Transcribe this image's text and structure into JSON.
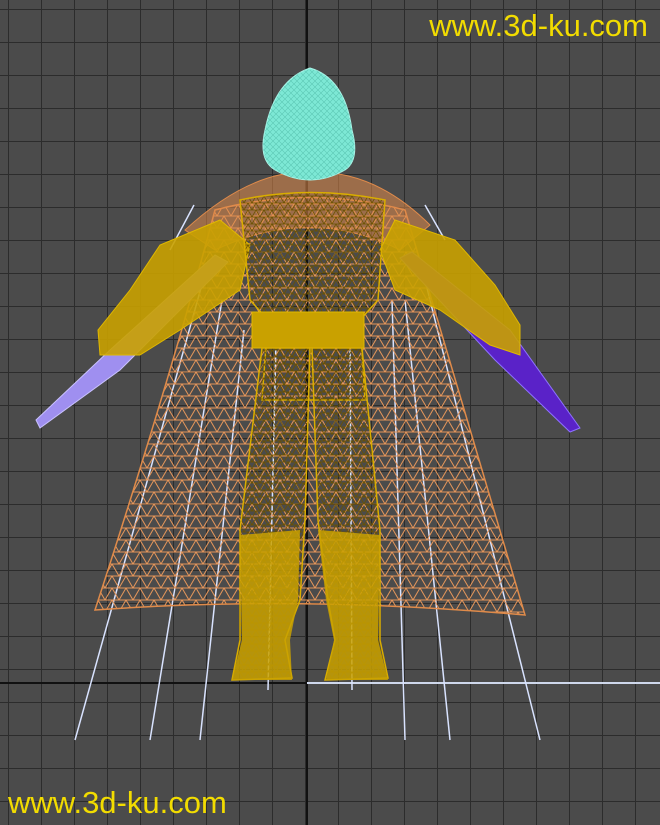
{
  "viewport": {
    "background_color": "#4b4b4b",
    "grid_color": "#2c2c2c",
    "axis_color": "#111111",
    "ground_line_color": "#cfd8ec"
  },
  "watermarks": {
    "top_right": "www.3d-ku.com",
    "bottom_left": "www.3d-ku.com",
    "color": "#f2dc00"
  },
  "model": {
    "hood_color": "#7de8d5",
    "body_color": "#c9a100",
    "cape_color": "#e08b4a",
    "left_blade_color": "#9f8ff0",
    "right_blade_color": "#5a22c8",
    "guide_line_color": "#d9e3ff"
  }
}
